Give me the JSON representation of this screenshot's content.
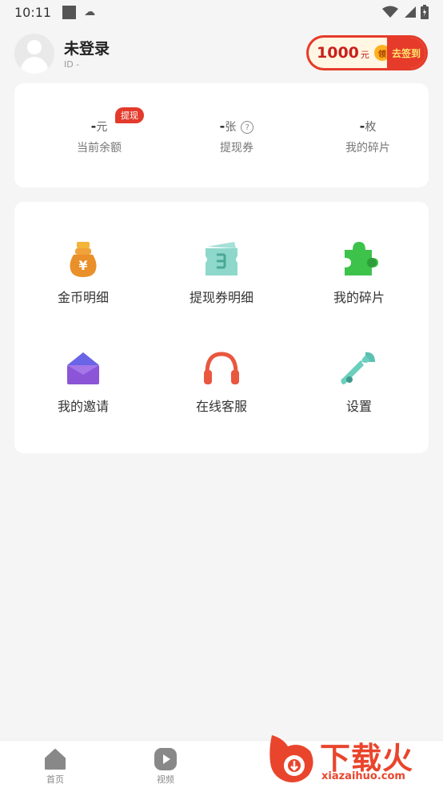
{
  "status_bar": {
    "time": "10:11",
    "icons": [
      "square-icon",
      "cloud-icon",
      "wifi-icon",
      "signal-icon",
      "battery-icon"
    ]
  },
  "header": {
    "username": "未登录",
    "user_id": "ID  -",
    "checkin": {
      "amount": "1000",
      "unit": "元",
      "claim": "领",
      "action": "去签到"
    }
  },
  "stats": {
    "withdraw_badge": "提现",
    "items": [
      {
        "value": "-",
        "unit": "元",
        "label": "当前余额"
      },
      {
        "value": "-",
        "unit": "张",
        "label": "提现券",
        "help": "?"
      },
      {
        "value": "-",
        "unit": "枚",
        "label": "我的碎片"
      }
    ]
  },
  "menu": {
    "items": [
      {
        "label": "金币明细",
        "icon": "money-bag-icon"
      },
      {
        "label": "提现券明细",
        "icon": "ticket-icon"
      },
      {
        "label": "我的碎片",
        "icon": "puzzle-icon"
      },
      {
        "label": "我的邀请",
        "icon": "envelope-icon"
      },
      {
        "label": "在线客服",
        "icon": "headphones-icon"
      },
      {
        "label": "设置",
        "icon": "wrench-icon"
      }
    ]
  },
  "bottom_nav": {
    "items": [
      {
        "label": "首页",
        "icon": "home-icon"
      },
      {
        "label": "视频",
        "icon": "play-icon"
      }
    ]
  },
  "watermark": {
    "title": "下载火",
    "url": "xiazaihuo.com"
  },
  "colors": {
    "accent_red": "#e63b2a",
    "background": "#f5f5f5",
    "card": "#ffffff"
  }
}
